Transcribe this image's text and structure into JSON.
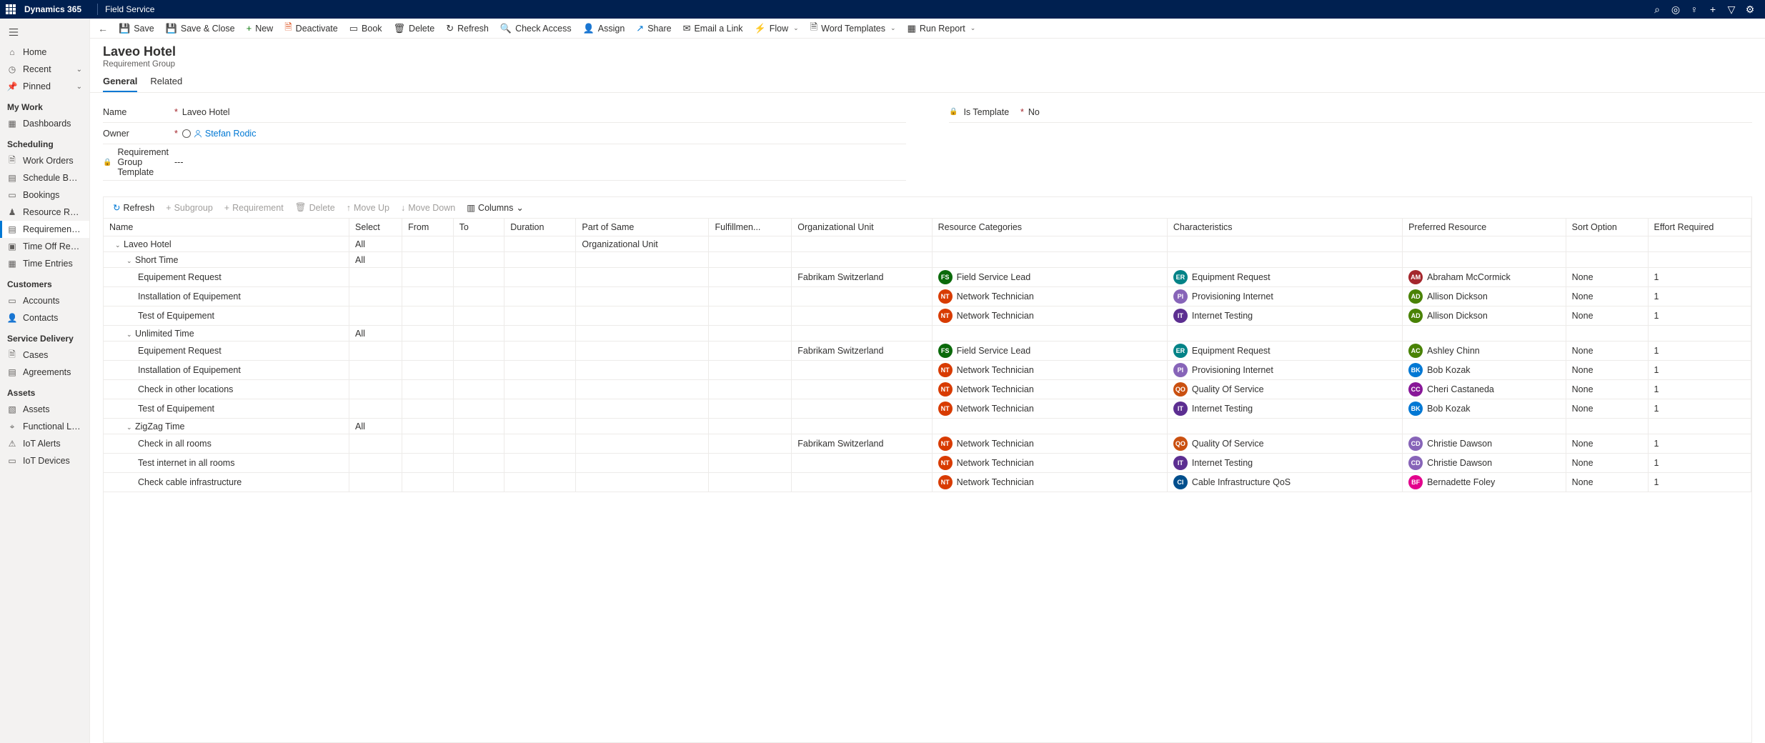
{
  "topbar": {
    "brand": "Dynamics 365",
    "app": "Field Service"
  },
  "sidebar": {
    "top": [
      {
        "icon": "home",
        "label": "Home"
      },
      {
        "icon": "clock",
        "label": "Recent",
        "chev": true
      },
      {
        "icon": "pin",
        "label": "Pinned",
        "chev": true
      }
    ],
    "groups": [
      {
        "title": "My Work",
        "items": [
          {
            "icon": "dash",
            "label": "Dashboards"
          }
        ]
      },
      {
        "title": "Scheduling",
        "items": [
          {
            "icon": "wo",
            "label": "Work Orders"
          },
          {
            "icon": "sb",
            "label": "Schedule Board"
          },
          {
            "icon": "bk",
            "label": "Bookings"
          },
          {
            "icon": "rr",
            "label": "Resource Requireme..."
          },
          {
            "icon": "rg",
            "label": "Requirement Groups",
            "active": true
          },
          {
            "icon": "to",
            "label": "Time Off Requests"
          },
          {
            "icon": "te",
            "label": "Time Entries"
          }
        ]
      },
      {
        "title": "Customers",
        "items": [
          {
            "icon": "ac",
            "label": "Accounts"
          },
          {
            "icon": "co",
            "label": "Contacts"
          }
        ]
      },
      {
        "title": "Service Delivery",
        "items": [
          {
            "icon": "cs",
            "label": "Cases"
          },
          {
            "icon": "ag",
            "label": "Agreements"
          }
        ]
      },
      {
        "title": "Assets",
        "items": [
          {
            "icon": "as",
            "label": "Assets"
          },
          {
            "icon": "fl",
            "label": "Functional Locations"
          },
          {
            "icon": "ia",
            "label": "IoT Alerts"
          },
          {
            "icon": "id",
            "label": "IoT Devices"
          }
        ]
      }
    ]
  },
  "cmdbar": [
    {
      "icon": "💾",
      "color": "#323130",
      "label": "Save"
    },
    {
      "icon": "💾",
      "color": "#323130",
      "label": "Save & Close"
    },
    {
      "icon": "+",
      "color": "#107c10",
      "label": "New"
    },
    {
      "icon": "🗎",
      "color": "#d83b01",
      "label": "Deactivate"
    },
    {
      "icon": "▭",
      "color": "#323130",
      "label": "Book"
    },
    {
      "icon": "🗑",
      "color": "#323130",
      "label": "Delete"
    },
    {
      "icon": "↻",
      "color": "#323130",
      "label": "Refresh"
    },
    {
      "icon": "🔍",
      "color": "#323130",
      "label": "Check Access"
    },
    {
      "icon": "👤",
      "color": "#323130",
      "label": "Assign"
    },
    {
      "icon": "↗",
      "color": "#0078d4",
      "label": "Share"
    },
    {
      "icon": "✉",
      "color": "#323130",
      "label": "Email a Link"
    },
    {
      "icon": "⚡",
      "color": "#323130",
      "label": "Flow",
      "chev": true
    },
    {
      "icon": "🗎",
      "color": "#323130",
      "label": "Word Templates",
      "chev": true
    },
    {
      "icon": "▦",
      "color": "#323130",
      "label": "Run Report",
      "chev": true
    }
  ],
  "header": {
    "title": "Laveo Hotel",
    "subtitle": "Requirement Group"
  },
  "tabs": [
    {
      "label": "General",
      "active": true
    },
    {
      "label": "Related"
    }
  ],
  "form": {
    "name_label": "Name",
    "name_value": "Laveo Hotel",
    "owner_label": "Owner",
    "owner_value": "Stefan Rodic",
    "tmpl_label": "Requirement Group Template",
    "tmpl_value": "---",
    "istmpl_label": "Is Template",
    "istmpl_value": "No"
  },
  "gridbar": [
    {
      "label": "Refresh",
      "icon": "↻",
      "color": "#0078d4"
    },
    {
      "label": "Subgroup",
      "icon": "+",
      "disabled": true
    },
    {
      "label": "Requirement",
      "icon": "+",
      "disabled": true
    },
    {
      "label": "Delete",
      "icon": "🗑",
      "disabled": true
    },
    {
      "label": "Move Up",
      "icon": "↑",
      "disabled": true
    },
    {
      "label": "Move Down",
      "icon": "↓",
      "disabled": true
    },
    {
      "label": "Columns",
      "icon": "▥",
      "chev": true
    }
  ],
  "columns": [
    "Name",
    "Select",
    "From",
    "To",
    "Duration",
    "Part of Same",
    "Fulfillmen...",
    "Organizational Unit",
    "Resource Categories",
    "Characteristics",
    "Preferred Resource",
    "Sort Option",
    "Effort Required"
  ],
  "rows": [
    {
      "indent": 0,
      "toggle": true,
      "name": "Laveo Hotel",
      "select": "All",
      "partOfSame": "Organizational Unit"
    },
    {
      "indent": 1,
      "toggle": true,
      "name": "Short Time",
      "select": "All"
    },
    {
      "indent": 2,
      "name": "Equipement Request",
      "org": "Fabrikam Switzerland",
      "rc": {
        "i": "FS",
        "c": "c-green",
        "t": "Field Service Lead"
      },
      "ch": {
        "i": "ER",
        "c": "c-teal",
        "t": "Equipment Request"
      },
      "pr": {
        "i": "AM",
        "c": "c-red",
        "t": "Abraham McCormick"
      },
      "sort": "None",
      "eff": "1"
    },
    {
      "indent": 2,
      "name": "Installation of Equipement",
      "rc": {
        "i": "NT",
        "c": "c-orange",
        "t": "Network Technician"
      },
      "ch": {
        "i": "PI",
        "c": "c-violet",
        "t": "Provisioning Internet"
      },
      "pr": {
        "i": "AD",
        "c": "c-lime",
        "t": "Allison Dickson"
      },
      "sort": "None",
      "eff": "1"
    },
    {
      "indent": 2,
      "name": "Test of Equipement",
      "rc": {
        "i": "NT",
        "c": "c-orange",
        "t": "Network Technician"
      },
      "ch": {
        "i": "IT",
        "c": "c-purple",
        "t": "Internet Testing"
      },
      "pr": {
        "i": "AD",
        "c": "c-lime",
        "t": "Allison Dickson"
      },
      "sort": "None",
      "eff": "1"
    },
    {
      "indent": 1,
      "toggle": true,
      "name": "Unlimited Time",
      "select": "All"
    },
    {
      "indent": 2,
      "name": "Equipement Request",
      "org": "Fabrikam Switzerland",
      "rc": {
        "i": "FS",
        "c": "c-green",
        "t": "Field Service Lead"
      },
      "ch": {
        "i": "ER",
        "c": "c-teal",
        "t": "Equipment Request"
      },
      "pr": {
        "i": "AC",
        "c": "c-lime",
        "t": "Ashley Chinn"
      },
      "sort": "None",
      "eff": "1"
    },
    {
      "indent": 2,
      "name": "Installation of Equipement",
      "rc": {
        "i": "NT",
        "c": "c-orange",
        "t": "Network Technician"
      },
      "ch": {
        "i": "PI",
        "c": "c-violet",
        "t": "Provisioning Internet"
      },
      "pr": {
        "i": "BK",
        "c": "c-blue",
        "t": "Bob Kozak"
      },
      "sort": "None",
      "eff": "1"
    },
    {
      "indent": 2,
      "name": "Check in other locations",
      "rc": {
        "i": "NT",
        "c": "c-orange",
        "t": "Network Technician"
      },
      "ch": {
        "i": "QO",
        "c": "c-darkorange",
        "t": "Quality Of Service"
      },
      "pr": {
        "i": "CC",
        "c": "c-magenta",
        "t": "Cheri Castaneda"
      },
      "sort": "None",
      "eff": "1"
    },
    {
      "indent": 2,
      "name": "Test of Equipement",
      "rc": {
        "i": "NT",
        "c": "c-orange",
        "t": "Network Technician"
      },
      "ch": {
        "i": "IT",
        "c": "c-purple",
        "t": "Internet Testing"
      },
      "pr": {
        "i": "BK",
        "c": "c-blue",
        "t": "Bob Kozak"
      },
      "sort": "None",
      "eff": "1"
    },
    {
      "indent": 1,
      "toggle": true,
      "name": "ZigZag Time",
      "select": "All"
    },
    {
      "indent": 2,
      "name": "Check in all rooms",
      "org": "Fabrikam Switzerland",
      "rc": {
        "i": "NT",
        "c": "c-orange",
        "t": "Network Technician"
      },
      "ch": {
        "i": "QO",
        "c": "c-darkorange",
        "t": "Quality Of Service"
      },
      "pr": {
        "i": "CD",
        "c": "c-violet",
        "t": "Christie Dawson"
      },
      "sort": "None",
      "eff": "1"
    },
    {
      "indent": 2,
      "name": "Test internet in all rooms",
      "rc": {
        "i": "NT",
        "c": "c-orange",
        "t": "Network Technician"
      },
      "ch": {
        "i": "IT",
        "c": "c-purple",
        "t": "Internet Testing"
      },
      "pr": {
        "i": "CD",
        "c": "c-violet",
        "t": "Christie Dawson"
      },
      "sort": "None",
      "eff": "1"
    },
    {
      "indent": 2,
      "name": "Check cable infrastructure",
      "rc": {
        "i": "NT",
        "c": "c-orange",
        "t": "Network Technician"
      },
      "ch": {
        "i": "CI",
        "c": "c-navy",
        "t": "Cable Infrastructure QoS"
      },
      "pr": {
        "i": "BF",
        "c": "c-pink",
        "t": "Bernadette Foley"
      },
      "sort": "None",
      "eff": "1"
    }
  ]
}
